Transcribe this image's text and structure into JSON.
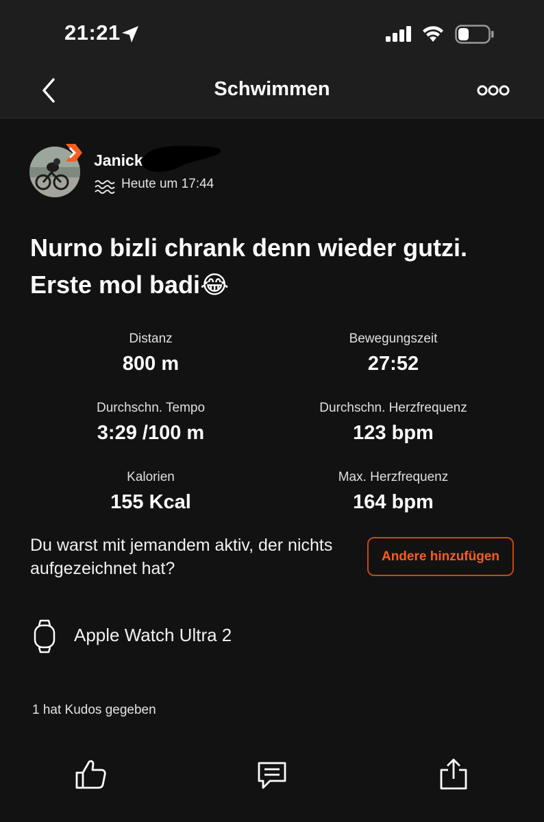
{
  "status_bar": {
    "time": "21:21"
  },
  "nav": {
    "title": "Schwimmen"
  },
  "athlete": {
    "first_name": "Janick",
    "timestamp": "Heute um 17:44"
  },
  "activity": {
    "title": "Nurno bizli chrank denn wieder gutzi. Erste mol badi😂"
  },
  "stats": [
    {
      "label": "Distanz",
      "value": "800 m"
    },
    {
      "label": "Bewegungszeit",
      "value": "27:52"
    },
    {
      "label": "Durchschn. Tempo",
      "value": "3:29 /100 m"
    },
    {
      "label": "Durchschn. Herzfrequenz",
      "value": "123 bpm"
    },
    {
      "label": "Kalorien",
      "value": "155 Kcal"
    },
    {
      "label": "Max. Herzfrequenz",
      "value": "164 bpm"
    }
  ],
  "partner_prompt": {
    "text": "Du warst mit jemandem aktiv, der nichts aufgezeichnet hat?",
    "button_label": "Andere hinzufügen"
  },
  "device": {
    "name": "Apple Watch Ultra 2"
  },
  "kudos": {
    "summary": "1 hat Kudos gegeben"
  },
  "actions": {
    "icons": [
      "thumbs-up-icon",
      "comment-icon",
      "share-icon"
    ]
  },
  "colors": {
    "accent": "#fc5d1e",
    "background": "#121212",
    "header": "#1e1e1e"
  }
}
